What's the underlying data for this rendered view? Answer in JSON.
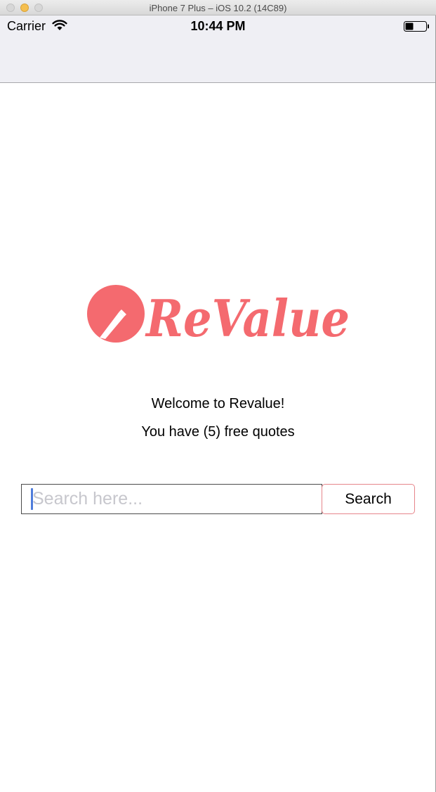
{
  "window": {
    "title": "iPhone 7 Plus – iOS 10.2 (14C89)"
  },
  "status_bar": {
    "carrier": "Carrier",
    "time": "10:44 PM",
    "icons": [
      "wifi-icon",
      "battery-icon"
    ]
  },
  "logo": {
    "text": "ReValue",
    "color": "#f46a6f"
  },
  "main": {
    "welcome": "Welcome to Revalue!",
    "quotes": "You have (5) free quotes"
  },
  "search": {
    "placeholder": "Search here...",
    "value": "",
    "button_label": "Search"
  },
  "colors": {
    "accent": "#f46a6f",
    "nav_background": "#efeff4",
    "caret": "#4f7cdb"
  }
}
